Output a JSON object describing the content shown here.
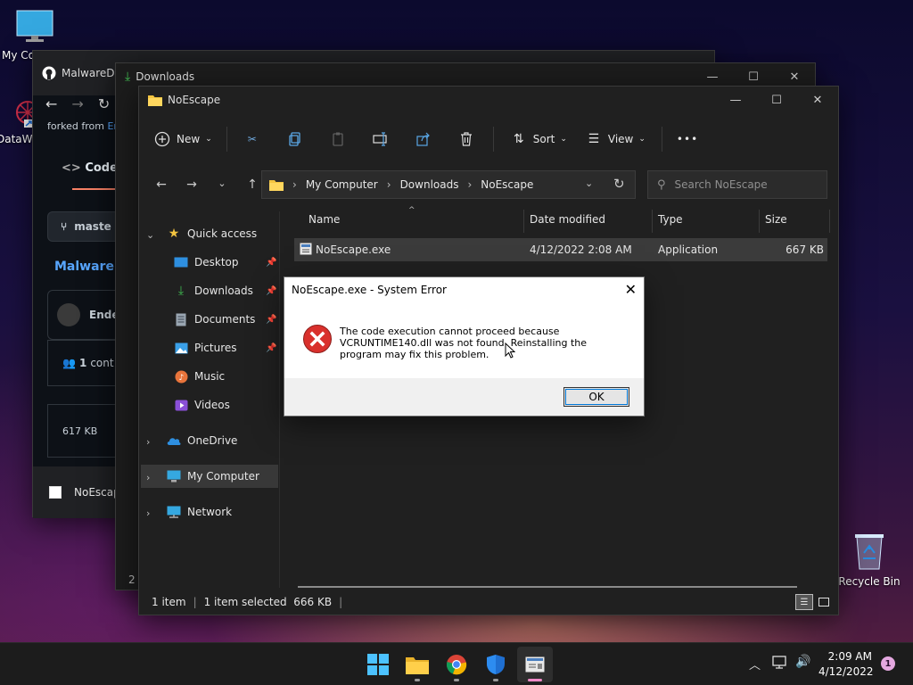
{
  "desktop": {
    "icons": [
      {
        "label": "My Co",
        "name": "my-computer"
      },
      {
        "label": "DataW",
        "name": "dataw"
      },
      {
        "label": "Recycle Bin",
        "name": "recycle-bin"
      }
    ]
  },
  "github_window": {
    "tab_title": "MalwareD",
    "forked_from": "forked from",
    "forked_link": "Er",
    "code_tab": "Code",
    "branch": "maste",
    "repo_name": "MalwareD",
    "author": "Ende",
    "contributors_count": "1",
    "contributors_label": "cont",
    "size": "617 KB",
    "taskbar_item": "NoEscap"
  },
  "downloads_window": {
    "title": "Downloads",
    "status_fragment": "2 i"
  },
  "explorer": {
    "title": "NoEscape",
    "toolbar": {
      "new_label": "New",
      "sort_label": "Sort",
      "view_label": "View",
      "more": "•••"
    },
    "breadcrumb": [
      "My Computer",
      "Downloads",
      "NoEscape"
    ],
    "search_placeholder": "Search NoEscape",
    "nav": {
      "quick_access": "Quick access",
      "desktop": "Desktop",
      "downloads": "Downloads",
      "documents": "Documents",
      "pictures": "Pictures",
      "music": "Music",
      "videos": "Videos",
      "onedrive": "OneDrive",
      "my_computer": "My Computer",
      "network": "Network"
    },
    "columns": {
      "name": "Name",
      "date": "Date modified",
      "type": "Type",
      "size": "Size"
    },
    "files": [
      {
        "name": "NoEscape.exe",
        "date": "4/12/2022 2:08 AM",
        "type": "Application",
        "size": "667 KB"
      }
    ],
    "status": {
      "count": "1 item",
      "selected": "1 item selected  666 KB"
    }
  },
  "dialog": {
    "title": "NoEscape.exe - System Error",
    "message": "The code execution cannot proceed because VCRUNTIME140.dll was not found. Reinstalling the program may fix this problem.",
    "ok": "OK"
  },
  "taskbar": {
    "time": "2:09 AM",
    "date": "4/12/2022",
    "notification_count": "1"
  },
  "colors": {
    "accent": "#0078d4",
    "error_red": "#d9302c",
    "explorer_bg": "#202020"
  }
}
